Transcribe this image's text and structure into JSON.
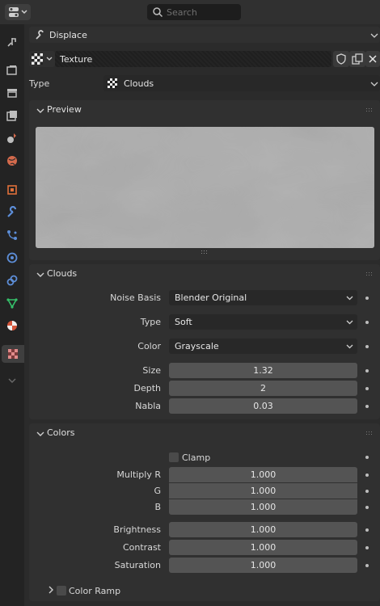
{
  "header": {
    "search_placeholder": "Search",
    "editor_icon": "properties-editor-icon"
  },
  "tabs": [
    {
      "name": "tool-tab-icon",
      "color": "#bdbdbd"
    },
    {
      "name": "render-tab-icon",
      "color": "#bdbdbd"
    },
    {
      "name": "output-tab-icon",
      "color": "#bdbdbd"
    },
    {
      "name": "view-layer-tab-icon",
      "color": "#bdbdbd"
    },
    {
      "name": "scene-tab-icon",
      "color": "#bdbdbd"
    },
    {
      "name": "world-tab-icon",
      "color": "#d46a4c"
    },
    {
      "name": "object-tab-icon",
      "color": "#e0703a"
    },
    {
      "name": "modifier-tab-icon",
      "color": "#5d8ed8"
    },
    {
      "name": "particles-tab-icon",
      "color": "#5d8ed8"
    },
    {
      "name": "physics-tab-icon",
      "color": "#5d8ed8"
    },
    {
      "name": "constraints-tab-icon",
      "color": "#5d8ed8"
    },
    {
      "name": "data-tab-icon",
      "color": "#36c06a"
    },
    {
      "name": "material-tab-icon",
      "color": "#d4553a"
    },
    {
      "name": "texture-tab-icon",
      "color": "#c86a6a"
    }
  ],
  "context": {
    "modifier_name": "Displace",
    "texture_name": "Texture",
    "type_label": "Type",
    "type_value": "Clouds"
  },
  "preview": {
    "title": "Preview"
  },
  "clouds": {
    "title": "Clouds",
    "noise_basis_label": "Noise Basis",
    "noise_basis_value": "Blender Original",
    "type_label": "Type",
    "type_value": "Soft",
    "color_label": "Color",
    "color_value": "Grayscale",
    "size_label": "Size",
    "size_value": "1.32",
    "depth_label": "Depth",
    "depth_value": "2",
    "nabla_label": "Nabla",
    "nabla_value": "0.03"
  },
  "colors": {
    "title": "Colors",
    "clamp_label": "Clamp",
    "multiply_r_label": "Multiply R",
    "multiply_r_value": "1.000",
    "g_label": "G",
    "g_value": "1.000",
    "b_label": "B",
    "b_value": "1.000",
    "brightness_label": "Brightness",
    "brightness_value": "1.000",
    "contrast_label": "Contrast",
    "contrast_value": "1.000",
    "saturation_label": "Saturation",
    "saturation_value": "1.000",
    "color_ramp_label": "Color Ramp"
  }
}
